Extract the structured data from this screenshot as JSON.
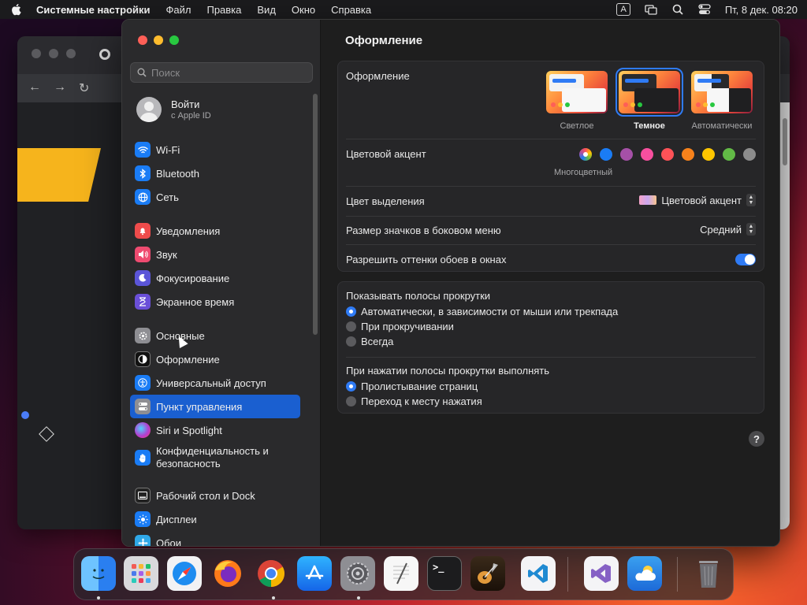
{
  "menubar": {
    "app_name": "Системные настройки",
    "items": [
      "Файл",
      "Правка",
      "Вид",
      "Окно",
      "Справка"
    ],
    "input_source": "A",
    "datetime": "Пт, 8 дек. 08:20"
  },
  "sidebar": {
    "search_placeholder": "Поиск",
    "account": {
      "title": "Войти",
      "subtitle": "с Apple ID"
    },
    "items": [
      {
        "label": "Wi-Fi",
        "icon": "wifi-icon",
        "color": "#1a7cf5"
      },
      {
        "label": "Bluetooth",
        "icon": "bluetooth-icon",
        "color": "#1a7cf5"
      },
      {
        "label": "Сеть",
        "icon": "globe-icon",
        "color": "#1a7cf5"
      },
      {
        "label": "Уведомления",
        "icon": "bell-icon",
        "color": "#ee4b4b"
      },
      {
        "label": "Звук",
        "icon": "speaker-icon",
        "color": "#ee4b70"
      },
      {
        "label": "Фокусирование",
        "icon": "moon-icon",
        "color": "#5b55d8"
      },
      {
        "label": "Экранное время",
        "icon": "hourglass-icon",
        "color": "#6a4fd8"
      },
      {
        "label": "Основные",
        "icon": "gear-icon",
        "color": "#8e8e93"
      },
      {
        "label": "Оформление",
        "icon": "appearance-icon",
        "color": "#111111"
      },
      {
        "label": "Универсальный доступ",
        "icon": "accessibility-icon",
        "color": "#1a7cf5"
      },
      {
        "label": "Пункт управления",
        "icon": "control-center-icon",
        "color": "#8e8e93",
        "active": true
      },
      {
        "label": "Siri и Spotlight",
        "icon": "siri-icon",
        "color": "#b23fd0"
      },
      {
        "label": "Конфиденциальность и безопасность",
        "icon": "hand-icon",
        "color": "#1a7cf5"
      },
      {
        "label": "Рабочий стол и Dock",
        "icon": "dock-icon",
        "color": "#222222"
      },
      {
        "label": "Дисплеи",
        "icon": "sun-icon",
        "color": "#1a7cf5"
      },
      {
        "label": "Обои",
        "icon": "wallpaper-icon",
        "color": "#2fa8e8"
      }
    ]
  },
  "main": {
    "title": "Оформление",
    "appearance": {
      "label": "Оформление",
      "options": [
        {
          "label": "Светлое",
          "selected": false
        },
        {
          "label": "Темное",
          "selected": true
        },
        {
          "label": "Автоматически",
          "selected": false
        }
      ]
    },
    "accent": {
      "label": "Цветовой акцент",
      "selected_label": "Многоцветный",
      "colors": [
        "multicolor",
        "#1a7cf5",
        "#a550a7",
        "#f74f9e",
        "#ff5257",
        "#f7821b",
        "#ffc600",
        "#62ba46",
        "#8c8c8c"
      ]
    },
    "highlight": {
      "label": "Цвет выделения",
      "value": "Цветовой акцент"
    },
    "sidebar_icon_size": {
      "label": "Размер значков в боковом меню",
      "value": "Средний"
    },
    "wallpaper_tinting": {
      "label": "Разрешить оттенки обоев в окнах",
      "on": true
    },
    "scrollbars": {
      "label": "Показывать полосы прокрутки",
      "options": [
        {
          "label": "Автоматически, в зависимости от мыши или трекпада",
          "selected": true
        },
        {
          "label": "При прокручивании",
          "selected": false
        },
        {
          "label": "Всегда",
          "selected": false
        }
      ]
    },
    "click_scrollbar": {
      "label": "При нажатии полосы прокрутки выполнять",
      "options": [
        {
          "label": "Пролистывание страниц",
          "selected": true
        },
        {
          "label": "Переход к месту нажатия",
          "selected": false
        }
      ]
    },
    "help": "?"
  },
  "dock": {
    "apps": [
      {
        "name": "Finder",
        "icon": "finder-icon"
      },
      {
        "name": "Launchpad",
        "icon": "launchpad-icon"
      },
      {
        "name": "Safari",
        "icon": "safari-icon"
      },
      {
        "name": "Firefox",
        "icon": "firefox-icon"
      },
      {
        "name": "Chrome",
        "icon": "chrome-icon"
      },
      {
        "name": "App Store",
        "icon": "app-store-icon"
      },
      {
        "name": "System Settings",
        "icon": "system-settings-icon"
      },
      {
        "name": "TextEdit",
        "icon": "textedit-icon"
      },
      {
        "name": "Terminal",
        "icon": "terminal-icon"
      },
      {
        "name": "GarageBand",
        "icon": "garageband-icon"
      },
      {
        "name": "VS Code",
        "icon": "vscode-icon"
      },
      {
        "name": "Visual Studio",
        "icon": "visual-studio-icon"
      },
      {
        "name": "Weather",
        "icon": "weather-icon"
      },
      {
        "name": "Trash",
        "icon": "trash-icon"
      }
    ],
    "terminal_prompt": ">_"
  }
}
